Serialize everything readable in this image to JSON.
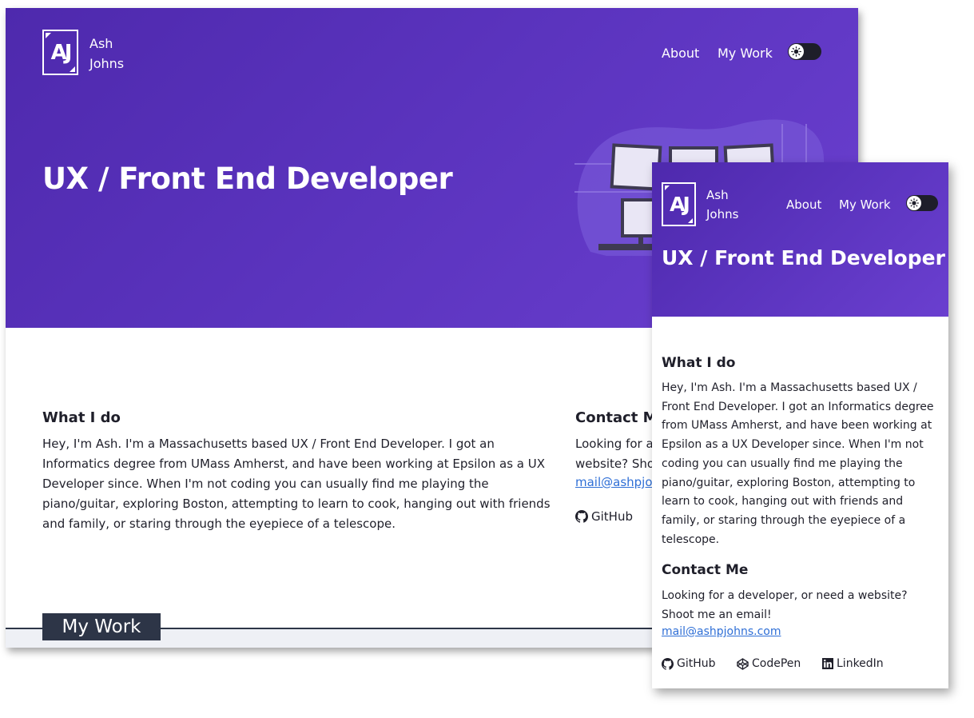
{
  "site": {
    "logo_letters": "AJ",
    "name_first": "Ash",
    "name_last": "Johns",
    "nav": {
      "about": "About",
      "work": "My Work"
    },
    "theme_toggle_icon": "sun-icon"
  },
  "hero": {
    "title": "UX / Front End Developer"
  },
  "what_i_do": {
    "heading": "What I do",
    "body": "Hey, I'm Ash. I'm a Massachusetts based UX / Front End Developer. I got an Informatics degree from UMass Amherst, and have been working at Epsilon as a UX Developer since. When I'm not coding you can usually find me playing the piano/guitar, exploring Boston, attempting to learn to cook, hanging out with friends and family, or staring through the eyepiece of a telescope."
  },
  "contact": {
    "heading": "Contact Me",
    "body": "Looking for a developer, or need a website? Shoot me an email!",
    "email": "mail@ashpjohns.com",
    "links": {
      "github": "GitHub",
      "codepen": "CodePen",
      "linkedin": "LinkedIn"
    }
  },
  "my_work_tab": "My Work",
  "colors": {
    "hero_start": "#4e29ad",
    "hero_end": "#6a3fcf",
    "link": "#2f6fd6",
    "dark": "#2d3547"
  }
}
